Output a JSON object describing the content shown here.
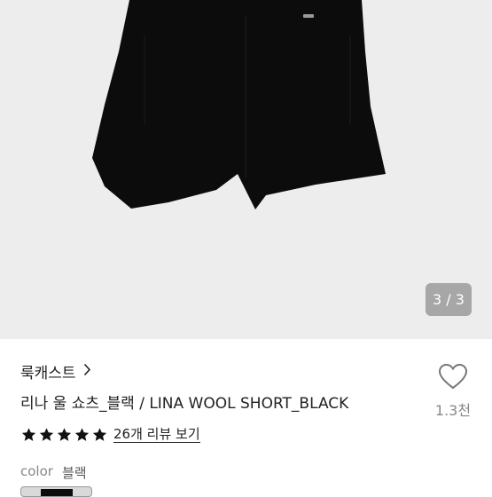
{
  "gallery": {
    "counter": "3 / 3"
  },
  "product": {
    "brand": "룩캐스트",
    "title": "리나 울 쇼츠_블랙 / LINA WOOL SHORT_BLACK",
    "rating_stars": 5,
    "review_link": "26개 리뷰 보기",
    "color_label": "color",
    "color_value": "블랙",
    "like_count": "1.3천"
  },
  "colors": {
    "star": "#111111",
    "product": "#0c0c0c",
    "gallery_bg": "#ededed"
  }
}
